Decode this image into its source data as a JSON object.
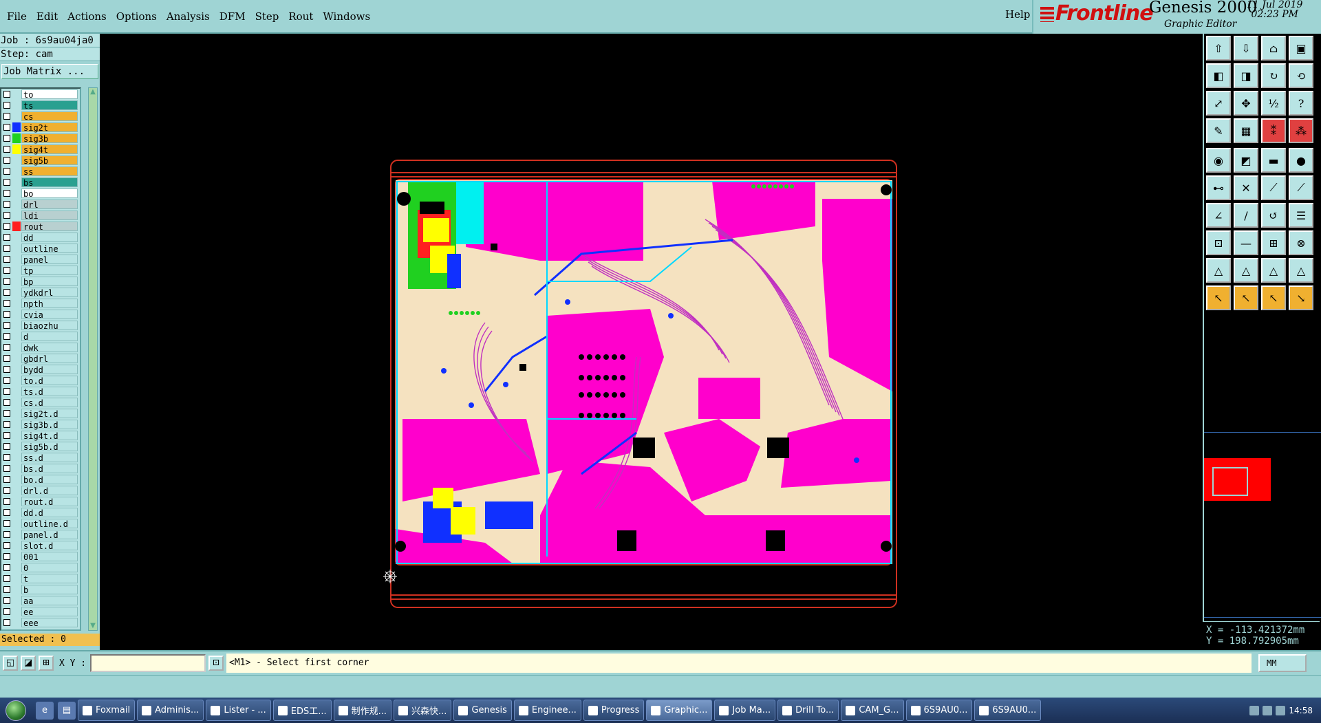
{
  "menubar": {
    "items": [
      "File",
      "Edit",
      "Actions",
      "Options",
      "Analysis",
      "DFM",
      "Step",
      "Rout",
      "Windows"
    ],
    "help": "Help"
  },
  "brand": {
    "logo": "Frontline",
    "product": "Genesis 2000",
    "subtitle": "Graphic Editor",
    "date": "11 Jul 2019",
    "time": "02:23 PM"
  },
  "left": {
    "job": "Job : 6s9au04ja0",
    "step": "Step: cam",
    "job_matrix": "Job Matrix ...",
    "selected": "Selected : 0",
    "layers": [
      {
        "name": "to",
        "bg": "#ffffff",
        "swatch": ""
      },
      {
        "name": "ts",
        "bg": "#2aa090",
        "swatch": ""
      },
      {
        "name": "cs",
        "bg": "#f0b030",
        "swatch": ""
      },
      {
        "name": "sig2t",
        "bg": "#f0b030",
        "swatch": "#1030ff"
      },
      {
        "name": "sig3b",
        "bg": "#f0b030",
        "swatch": "#20d020"
      },
      {
        "name": "sig4t",
        "bg": "#f0b030",
        "swatch": "#ffff00"
      },
      {
        "name": "sig5b",
        "bg": "#f0b030",
        "swatch": ""
      },
      {
        "name": "ss",
        "bg": "#f0b030",
        "swatch": ""
      },
      {
        "name": "bs",
        "bg": "#2aa090",
        "swatch": ""
      },
      {
        "name": "bo",
        "bg": "#ffffff",
        "swatch": ""
      },
      {
        "name": "drl",
        "bg": "#b8d0d0",
        "swatch": ""
      },
      {
        "name": "ldi",
        "bg": "#b8d0d0",
        "swatch": ""
      },
      {
        "name": "rout",
        "bg": "#b8d0d0",
        "swatch": "#ff2020"
      },
      {
        "name": "dd",
        "bg": "#b8e4e4",
        "swatch": ""
      },
      {
        "name": "outline",
        "bg": "#b8e4e4",
        "swatch": ""
      },
      {
        "name": "panel",
        "bg": "#b8e4e4",
        "swatch": ""
      },
      {
        "name": "tp",
        "bg": "#b8e4e4",
        "swatch": ""
      },
      {
        "name": "bp",
        "bg": "#b8e4e4",
        "swatch": ""
      },
      {
        "name": "ydkdrl",
        "bg": "#b8e4e4",
        "swatch": ""
      },
      {
        "name": "npth",
        "bg": "#b8e4e4",
        "swatch": ""
      },
      {
        "name": "cvia",
        "bg": "#b8e4e4",
        "swatch": ""
      },
      {
        "name": "biaozhu",
        "bg": "#b8e4e4",
        "swatch": ""
      },
      {
        "name": "d",
        "bg": "#b8e4e4",
        "swatch": ""
      },
      {
        "name": "dwk",
        "bg": "#b8e4e4",
        "swatch": ""
      },
      {
        "name": "gbdrl",
        "bg": "#b8e4e4",
        "swatch": ""
      },
      {
        "name": "bydd",
        "bg": "#b8e4e4",
        "swatch": ""
      },
      {
        "name": "to.d",
        "bg": "#b8e4e4",
        "swatch": ""
      },
      {
        "name": "ts.d",
        "bg": "#b8e4e4",
        "swatch": ""
      },
      {
        "name": "cs.d",
        "bg": "#b8e4e4",
        "swatch": ""
      },
      {
        "name": "sig2t.d",
        "bg": "#b8e4e4",
        "swatch": ""
      },
      {
        "name": "sig3b.d",
        "bg": "#b8e4e4",
        "swatch": ""
      },
      {
        "name": "sig4t.d",
        "bg": "#b8e4e4",
        "swatch": ""
      },
      {
        "name": "sig5b.d",
        "bg": "#b8e4e4",
        "swatch": ""
      },
      {
        "name": "ss.d",
        "bg": "#b8e4e4",
        "swatch": ""
      },
      {
        "name": "bs.d",
        "bg": "#b8e4e4",
        "swatch": ""
      },
      {
        "name": "bo.d",
        "bg": "#b8e4e4",
        "swatch": ""
      },
      {
        "name": "drl.d",
        "bg": "#b8e4e4",
        "swatch": ""
      },
      {
        "name": "rout.d",
        "bg": "#b8e4e4",
        "swatch": ""
      },
      {
        "name": "dd.d",
        "bg": "#b8e4e4",
        "swatch": ""
      },
      {
        "name": "outline.d",
        "bg": "#b8e4e4",
        "swatch": ""
      },
      {
        "name": "panel.d",
        "bg": "#b8e4e4",
        "swatch": ""
      },
      {
        "name": "slot.d",
        "bg": "#b8e4e4",
        "swatch": ""
      },
      {
        "name": "001",
        "bg": "#b8e4e4",
        "swatch": ""
      },
      {
        "name": "0",
        "bg": "#b8e4e4",
        "swatch": ""
      },
      {
        "name": "t",
        "bg": "#b8e4e4",
        "swatch": ""
      },
      {
        "name": "b",
        "bg": "#b8e4e4",
        "swatch": ""
      },
      {
        "name": "aa",
        "bg": "#b8e4e4",
        "swatch": ""
      },
      {
        "name": "ee",
        "bg": "#b8e4e4",
        "swatch": ""
      },
      {
        "name": "eee",
        "bg": "#b8e4e4",
        "swatch": ""
      }
    ]
  },
  "coords": {
    "x": "X = -113.421372mm",
    "y": "Y = 198.792905mm"
  },
  "cmd": {
    "xy_label": "X Y :",
    "message": "<M1> - Select first corner",
    "unit": "MM"
  },
  "taskbar": {
    "items": [
      "Foxmail",
      "Adminis...",
      "Lister - ...",
      "EDS工...",
      "制作规...",
      "兴森快...",
      "Genesis",
      "Enginee...",
      "Progress",
      "Graphic...",
      "Job Ma...",
      "Drill To...",
      "CAM_G...",
      "6S9AU0...",
      "6S9AU0..."
    ],
    "active_index": 9,
    "clock": "14:58"
  },
  "colors": {
    "board_fill": "#ff00cc",
    "board_bg": "#f5e2c0",
    "outline": "#d03020",
    "panel_cyan": "#00d8ff"
  }
}
